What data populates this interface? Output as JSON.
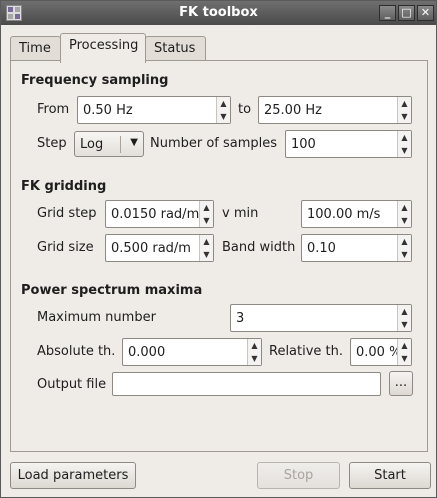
{
  "window": {
    "title": "FK toolbox"
  },
  "tabs": [
    {
      "label": "Time",
      "active": false
    },
    {
      "label": "Processing",
      "active": true
    },
    {
      "label": "Status",
      "active": false
    }
  ],
  "frequency_sampling": {
    "title": "Frequency sampling",
    "from_label": "From",
    "from_value": "0.50 Hz",
    "to_label": "to",
    "to_value": "25.00 Hz",
    "step_label": "Step",
    "step_value": "Log",
    "nsamples_label": "Number of samples",
    "nsamples_value": "100"
  },
  "fk_gridding": {
    "title": "FK gridding",
    "grid_step_label": "Grid step",
    "grid_step_value": "0.0150 rad/m",
    "vmin_label": "v min",
    "vmin_value": "100.00 m/s",
    "grid_size_label": "Grid size",
    "grid_size_value": "0.500 rad/m",
    "bandwidth_label": "Band width",
    "bandwidth_value": "0.10"
  },
  "power_spectrum": {
    "title": "Power spectrum maxima",
    "max_number_label": "Maximum number",
    "max_number_value": "3",
    "abs_th_label": "Absolute th.",
    "abs_th_value": "0.000",
    "rel_th_label": "Relative th.",
    "rel_th_value": "0.00 %",
    "output_file_label": "Output file",
    "output_file_value": "",
    "browse_label": "..."
  },
  "buttons": {
    "load": "Load parameters",
    "stop": "Stop",
    "start": "Start"
  },
  "titlebar_buttons": {
    "minimize": "_",
    "maximize": "□",
    "close": "✕"
  }
}
